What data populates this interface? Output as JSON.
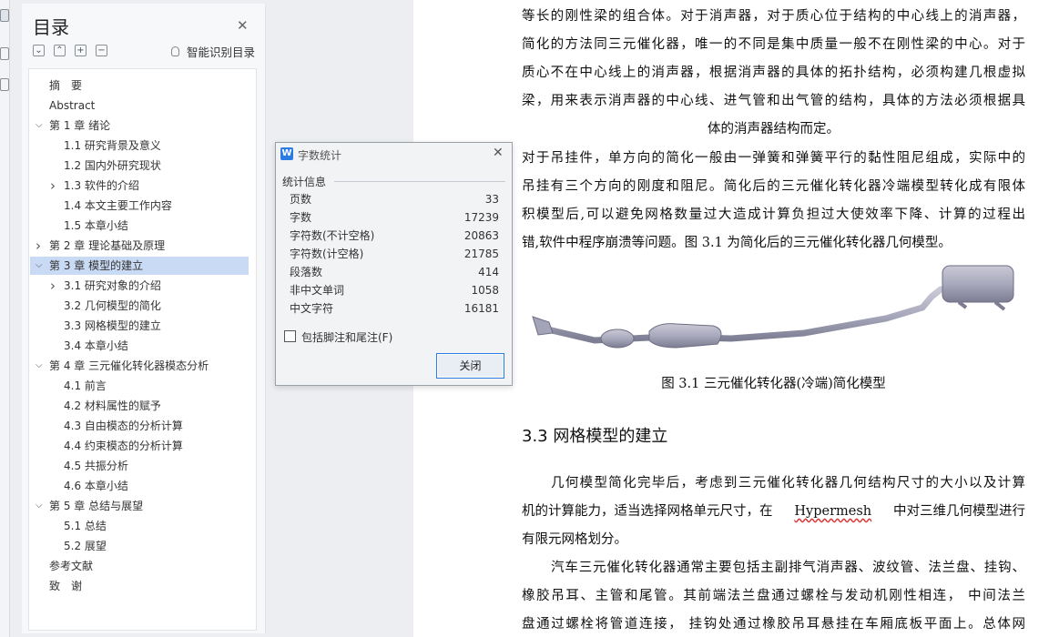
{
  "toc": {
    "title": "目录",
    "smart_label": "智能识别目录",
    "items": [
      {
        "label": "摘　要",
        "level": 0,
        "arrow": ""
      },
      {
        "label": "Abstract",
        "level": 0,
        "arrow": ""
      },
      {
        "label": "第 1 章  绪论",
        "level": 0,
        "arrow": "expanded"
      },
      {
        "label": "1.1 研究背景及意义",
        "level": 1,
        "arrow": ""
      },
      {
        "label": "1.2 国内外研究现状",
        "level": 1,
        "arrow": ""
      },
      {
        "label": "1.3 软件的介绍",
        "level": 1,
        "arrow": "collapsed"
      },
      {
        "label": "1.4 本文主要工作内容",
        "level": 1,
        "arrow": ""
      },
      {
        "label": "1.5  本章小结",
        "level": 1,
        "arrow": ""
      },
      {
        "label": "第 2 章  理论基础及原理",
        "level": 0,
        "arrow": "collapsed"
      },
      {
        "label": "第 3 章  模型的建立",
        "level": 0,
        "arrow": "expanded",
        "selected": true
      },
      {
        "label": "3.1  研究对象的介绍",
        "level": 1,
        "arrow": "collapsed"
      },
      {
        "label": "3.2  几何模型的简化",
        "level": 1,
        "arrow": ""
      },
      {
        "label": "3.3  网格模型的建立",
        "level": 1,
        "arrow": ""
      },
      {
        "label": "3.4  本章小结",
        "level": 1,
        "arrow": ""
      },
      {
        "label": "第 4 章  三元催化转化器模态分析",
        "level": 0,
        "arrow": "expanded"
      },
      {
        "label": "4.1  前言",
        "level": 1,
        "arrow": ""
      },
      {
        "label": "4.2  材料属性的赋予",
        "level": 1,
        "arrow": ""
      },
      {
        "label": "4.3  自由模态的分析计算",
        "level": 1,
        "arrow": ""
      },
      {
        "label": "4.4  约束模态的分析计算",
        "level": 1,
        "arrow": ""
      },
      {
        "label": "4.5  共振分析",
        "level": 1,
        "arrow": ""
      },
      {
        "label": "4.6  本章小结",
        "level": 1,
        "arrow": ""
      },
      {
        "label": "第 5 章  总结与展望",
        "level": 0,
        "arrow": "expanded"
      },
      {
        "label": "5.1  总结",
        "level": 1,
        "arrow": ""
      },
      {
        "label": "5.2  展望",
        "level": 1,
        "arrow": ""
      },
      {
        "label": "参考文献",
        "level": 0,
        "arrow": ""
      },
      {
        "label": "致　谢",
        "level": 0,
        "arrow": ""
      }
    ]
  },
  "dialog": {
    "title": "字数统计",
    "section": "统计信息",
    "stats": [
      {
        "label": "页数",
        "value": "33"
      },
      {
        "label": "字数",
        "value": "17239"
      },
      {
        "label": "字符数(不计空格)",
        "value": "20863"
      },
      {
        "label": "字符数(计空格)",
        "value": "21785"
      },
      {
        "label": "段落数",
        "value": "414"
      },
      {
        "label": "非中文单词",
        "value": "1058"
      },
      {
        "label": "中文字符",
        "value": "16181"
      }
    ],
    "checkbox_label": "包括脚注和尾注(F)",
    "close_label": "关闭"
  },
  "doc": {
    "para1": [
      "等长的刚性梁的组合体。对于消声器，对于质心位于结构的中心线上的消声器，",
      "简化的方法同三元催化器，唯一的不同是集中质量一般不在刚性梁的中心。对于",
      "质心不在中心线上的消声器，根据消声器的具体的拓扑结构，必须构建几根虚拟",
      "梁，用来表示消声器的中心线、进气管和出气管的结构，具体的方法必须根据具",
      "体的消声器结构而定。"
    ],
    "para2": [
      "对于吊挂件，单方向的简化一般由一弹簧和弹簧平行的黏性阻尼组成，实际中的",
      "吊挂有三个方向的刚度和阻尼。简化后的三元催化转化器冷端模型转化成有限体",
      "积模型后,可以避免网格数量过大造成计算负担过大使效率下降、计算的过程出",
      "错,软件中程序崩溃等问题。图 3.1 为简化后的三元催化转化器几何模型。"
    ],
    "figure_caption": "图 3.1  三元催化转化器(冷端)简化模型",
    "section_heading": "3.3  网格模型的建立",
    "para3_l1": "几何模型简化完毕后，考虑到三元催化转化器几何结构尺寸的大小以及计算",
    "para3_l2a": "机的计算能力，适当选择网格单元尺寸，在 ",
    "para3_l2b": "Hypermesh",
    "para3_l2c": " 中对三维几何模型进行",
    "para3_l3": "有限元网格划分。",
    "para4": [
      "汽车三元催化转化器通常主要包括主副排气消声器、波纹管、法兰盘、挂钩、",
      "橡胶吊耳、主管和尾管。其前端法兰盘通过螺栓与发动机刚性相连，  中间法兰",
      "盘通过螺栓将管道连接，  挂钩处通过橡胶吊耳悬挂在车厢底板平面上。总体网"
    ]
  }
}
